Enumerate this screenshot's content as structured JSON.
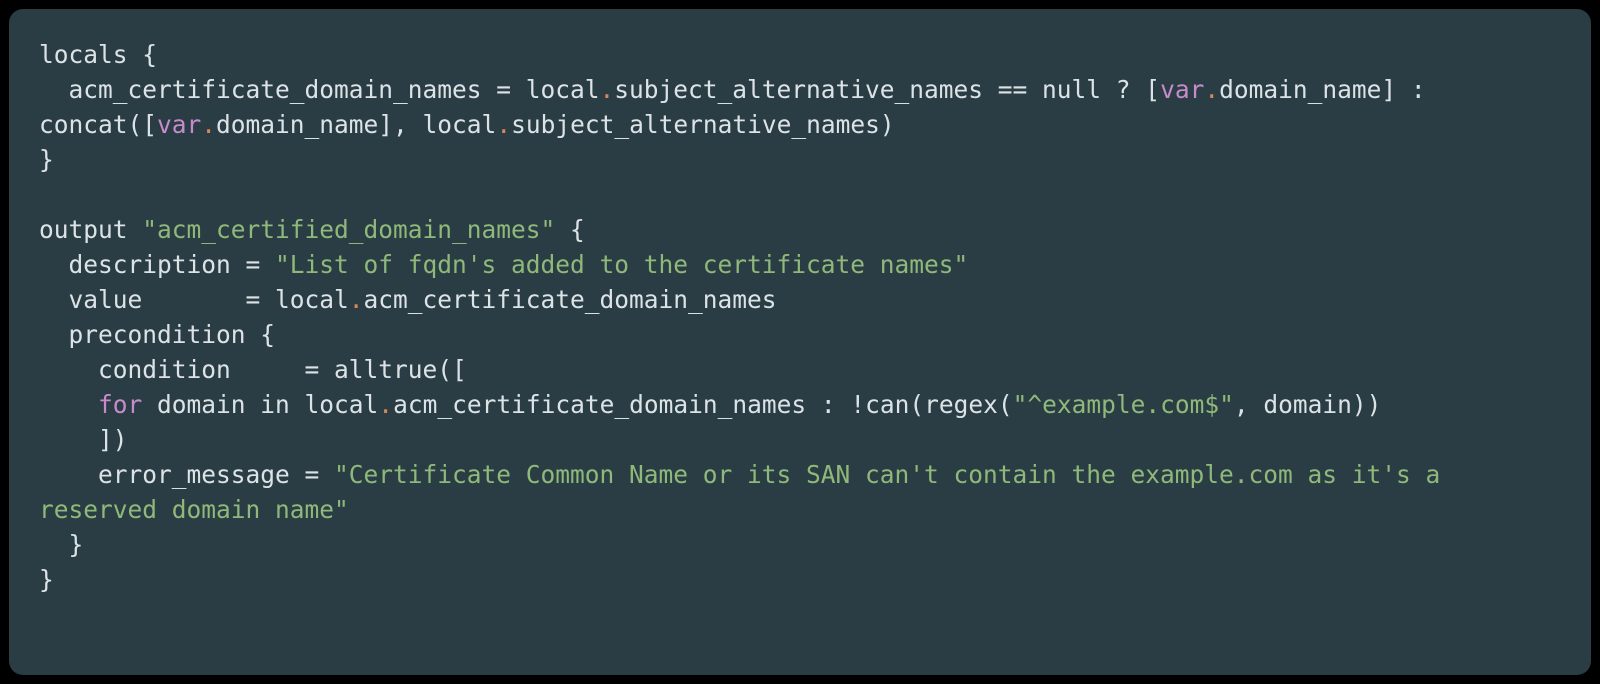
{
  "code": {
    "tokens": [
      {
        "t": "locals {\n",
        "c": "plain"
      },
      {
        "t": "  acm_certificate_domain_names = local",
        "c": "plain"
      },
      {
        "t": ".",
        "c": "dot"
      },
      {
        "t": "subject_alternative_names == null ? [",
        "c": "plain"
      },
      {
        "t": "var",
        "c": "kw"
      },
      {
        "t": ".",
        "c": "dot"
      },
      {
        "t": "domain_name] : concat([",
        "c": "plain"
      },
      {
        "t": "var",
        "c": "kw"
      },
      {
        "t": ".",
        "c": "dot"
      },
      {
        "t": "domain_name], local",
        "c": "plain"
      },
      {
        "t": ".",
        "c": "dot"
      },
      {
        "t": "subject_alternative_names)\n",
        "c": "plain"
      },
      {
        "t": "}\n",
        "c": "plain"
      },
      {
        "t": "\n",
        "c": "plain"
      },
      {
        "t": "output ",
        "c": "plain"
      },
      {
        "t": "\"acm_certified_domain_names\"",
        "c": "str"
      },
      {
        "t": " {\n",
        "c": "plain"
      },
      {
        "t": "  description = ",
        "c": "plain"
      },
      {
        "t": "\"List of fqdn's added to the certificate names\"",
        "c": "str"
      },
      {
        "t": "\n",
        "c": "plain"
      },
      {
        "t": "  value       = local",
        "c": "plain"
      },
      {
        "t": ".",
        "c": "dot"
      },
      {
        "t": "acm_certificate_domain_names\n",
        "c": "plain"
      },
      {
        "t": "  precondition {\n",
        "c": "plain"
      },
      {
        "t": "    condition     = alltrue([\n",
        "c": "plain"
      },
      {
        "t": "    ",
        "c": "plain"
      },
      {
        "t": "for",
        "c": "kw"
      },
      {
        "t": " domain in local",
        "c": "plain"
      },
      {
        "t": ".",
        "c": "dot"
      },
      {
        "t": "acm_certificate_domain_names : !can(regex(",
        "c": "plain"
      },
      {
        "t": "\"^example.com$\"",
        "c": "str"
      },
      {
        "t": ", domain))\n",
        "c": "plain"
      },
      {
        "t": "    ])\n",
        "c": "plain"
      },
      {
        "t": "    error_message = ",
        "c": "plain"
      },
      {
        "t": "\"Certificate Common Name or its SAN can't contain the example.com as it's a reserved domain name\"",
        "c": "str"
      },
      {
        "t": "\n",
        "c": "plain"
      },
      {
        "t": "  }\n",
        "c": "plain"
      },
      {
        "t": "}",
        "c": "plain"
      }
    ]
  }
}
